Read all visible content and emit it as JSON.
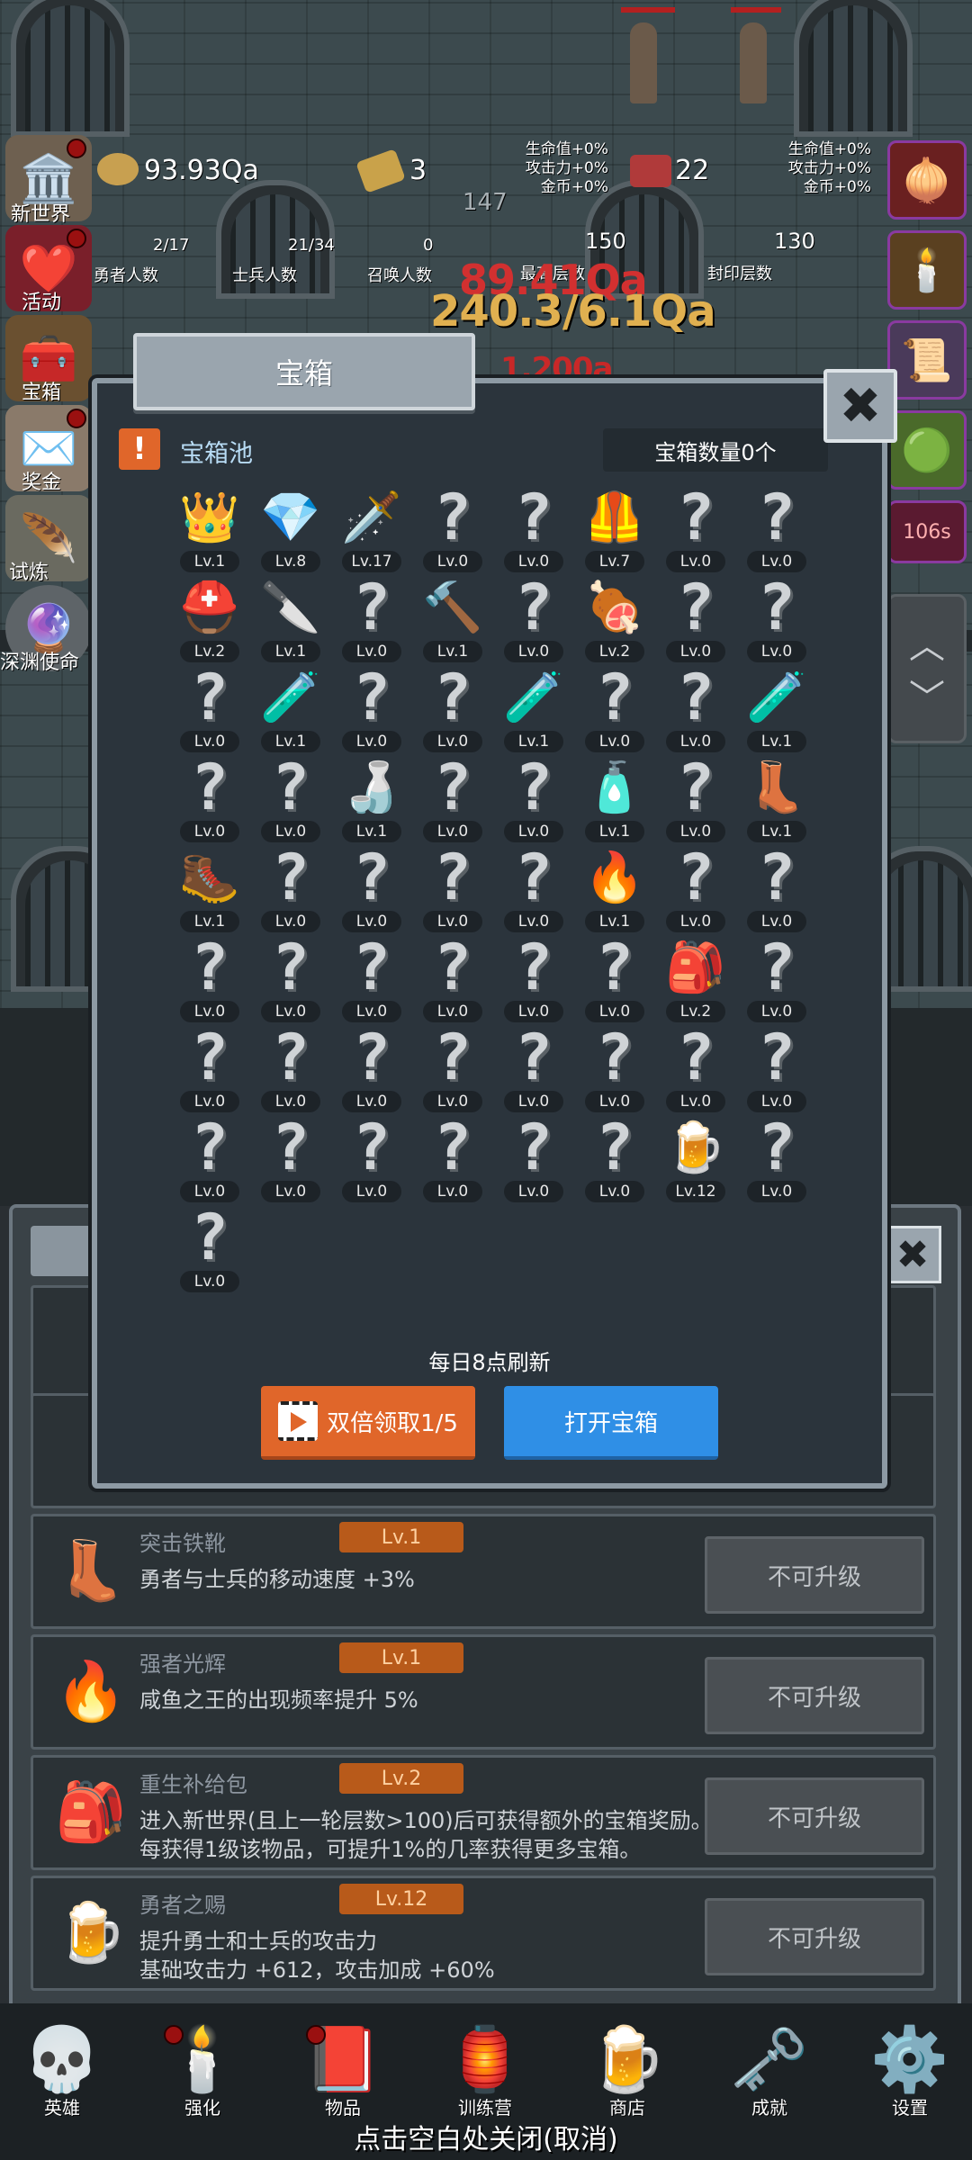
{
  "hud": {
    "gold": "93.93Qa",
    "gold_bars": "3",
    "gems": "22",
    "center_value": "147",
    "left_bonus": [
      "生命值+0%",
      "攻击力+0%",
      "金币+0%"
    ],
    "right_bonus": [
      "生命值+0%",
      "攻击力+0%",
      "金币+0%"
    ],
    "hero_count": "2/17",
    "hero_label": "勇者人数",
    "soldier_count": "21/34",
    "soldier_label": "士兵人数",
    "summon_count": "0",
    "summon_label": "召唤人数",
    "max_floor": "150",
    "max_floor_label": "最高层数",
    "sealed_floor": "130",
    "sealed_floor_label": "封印层数",
    "float_1": "89.41Qa",
    "float_2": "240.3/6.1Qa",
    "float_3": "1.200a",
    "timer": "106s"
  },
  "left_menu": [
    {
      "label": "新世界",
      "icon": "ruins-icon"
    },
    {
      "label": "活动",
      "icon": "heart-icon"
    },
    {
      "label": "宝箱",
      "icon": "chest-icon"
    },
    {
      "label": "奖金",
      "icon": "envelope-icon"
    },
    {
      "label": "试炼",
      "icon": "wing-icon"
    },
    {
      "label": "深渊使命",
      "icon": "orb-icon"
    }
  ],
  "modal": {
    "title": "宝箱",
    "pool_title": "宝箱池",
    "chest_count": "宝箱数量0个",
    "refresh_note": "每日8点刷新",
    "double_button": "双倍领取1/5",
    "open_button": "打开宝箱",
    "items": [
      {
        "icon": "👑",
        "lv": "Lv.1"
      },
      {
        "icon": "💎",
        "lv": "Lv.8"
      },
      {
        "icon": "🗡️",
        "lv": "Lv.17"
      },
      {
        "icon": "?",
        "lv": "Lv.0"
      },
      {
        "icon": "?",
        "lv": "Lv.0"
      },
      {
        "icon": "🦺",
        "lv": "Lv.7"
      },
      {
        "icon": "?",
        "lv": "Lv.0"
      },
      {
        "icon": "?",
        "lv": "Lv.0"
      },
      {
        "icon": "⛑️",
        "lv": "Lv.2"
      },
      {
        "icon": "🔪",
        "lv": "Lv.1"
      },
      {
        "icon": "?",
        "lv": "Lv.0"
      },
      {
        "icon": "🔨",
        "lv": "Lv.1"
      },
      {
        "icon": "?",
        "lv": "Lv.0"
      },
      {
        "icon": "🍖",
        "lv": "Lv.2"
      },
      {
        "icon": "?",
        "lv": "Lv.0"
      },
      {
        "icon": "?",
        "lv": "Lv.0"
      },
      {
        "icon": "?",
        "lv": "Lv.0"
      },
      {
        "icon": "🧪",
        "lv": "Lv.1"
      },
      {
        "icon": "?",
        "lv": "Lv.0"
      },
      {
        "icon": "?",
        "lv": "Lv.0"
      },
      {
        "icon": "🧪",
        "lv": "Lv.1"
      },
      {
        "icon": "?",
        "lv": "Lv.0"
      },
      {
        "icon": "?",
        "lv": "Lv.0"
      },
      {
        "icon": "🧪",
        "lv": "Lv.1"
      },
      {
        "icon": "?",
        "lv": "Lv.0"
      },
      {
        "icon": "?",
        "lv": "Lv.0"
      },
      {
        "icon": "🍶",
        "lv": "Lv.1"
      },
      {
        "icon": "?",
        "lv": "Lv.0"
      },
      {
        "icon": "?",
        "lv": "Lv.0"
      },
      {
        "icon": "🧴",
        "lv": "Lv.1"
      },
      {
        "icon": "?",
        "lv": "Lv.0"
      },
      {
        "icon": "👢",
        "lv": "Lv.1"
      },
      {
        "icon": "🥾",
        "lv": "Lv.1"
      },
      {
        "icon": "?",
        "lv": "Lv.0"
      },
      {
        "icon": "?",
        "lv": "Lv.0"
      },
      {
        "icon": "?",
        "lv": "Lv.0"
      },
      {
        "icon": "?",
        "lv": "Lv.0"
      },
      {
        "icon": "🔥",
        "lv": "Lv.1"
      },
      {
        "icon": "?",
        "lv": "Lv.0"
      },
      {
        "icon": "?",
        "lv": "Lv.0"
      },
      {
        "icon": "?",
        "lv": "Lv.0"
      },
      {
        "icon": "?",
        "lv": "Lv.0"
      },
      {
        "icon": "?",
        "lv": "Lv.0"
      },
      {
        "icon": "?",
        "lv": "Lv.0"
      },
      {
        "icon": "?",
        "lv": "Lv.0"
      },
      {
        "icon": "?",
        "lv": "Lv.0"
      },
      {
        "icon": "🎒",
        "lv": "Lv.2"
      },
      {
        "icon": "?",
        "lv": "Lv.0"
      },
      {
        "icon": "?",
        "lv": "Lv.0"
      },
      {
        "icon": "?",
        "lv": "Lv.0"
      },
      {
        "icon": "?",
        "lv": "Lv.0"
      },
      {
        "icon": "?",
        "lv": "Lv.0"
      },
      {
        "icon": "?",
        "lv": "Lv.0"
      },
      {
        "icon": "?",
        "lv": "Lv.0"
      },
      {
        "icon": "?",
        "lv": "Lv.0"
      },
      {
        "icon": "?",
        "lv": "Lv.0"
      },
      {
        "icon": "?",
        "lv": "Lv.0"
      },
      {
        "icon": "?",
        "lv": "Lv.0"
      },
      {
        "icon": "?",
        "lv": "Lv.0"
      },
      {
        "icon": "?",
        "lv": "Lv.0"
      },
      {
        "icon": "?",
        "lv": "Lv.0"
      },
      {
        "icon": "?",
        "lv": "Lv.0"
      },
      {
        "icon": "🍺",
        "lv": "Lv.12"
      },
      {
        "icon": "?",
        "lv": "Lv.0"
      },
      {
        "icon": "?",
        "lv": "Lv.0"
      }
    ]
  },
  "list_rows": [
    {
      "icon": "👢",
      "name": "突击铁靴",
      "lv": "Lv.1",
      "desc": [
        "勇者与士兵的移动速度 +3%"
      ],
      "button": "不可升级"
    },
    {
      "icon": "🔥",
      "name": "强者光辉",
      "lv": "Lv.1",
      "desc": [
        "咸鱼之王的出现频率提升 5%"
      ],
      "button": "不可升级"
    },
    {
      "icon": "🎒",
      "name": "重生补给包",
      "lv": "Lv.2",
      "desc": [
        "进入新世界(且上一轮层数>100)后可获得额外的宝箱奖励。",
        "每获得1级该物品，可提升1%的几率获得更多宝箱。"
      ],
      "button": "不可升级"
    },
    {
      "icon": "🍺",
      "name": "勇者之赐",
      "lv": "Lv.12",
      "desc": [
        "提升勇士和士兵的攻击力",
        "基础攻击力 +612，攻击加成 +60%"
      ],
      "button": "不可升级"
    }
  ],
  "bottom_nav": [
    {
      "label": "英雄",
      "icon": "💀"
    },
    {
      "label": "强化",
      "icon": "🕯️"
    },
    {
      "label": "物品",
      "icon": "📕"
    },
    {
      "label": "训练营",
      "icon": "🏮"
    },
    {
      "label": "商店",
      "icon": "🍺"
    },
    {
      "label": "成就",
      "icon": "🗝️"
    },
    {
      "label": "设置",
      "icon": "⚙️"
    }
  ],
  "close_hint": "点击空白处关闭(取消)"
}
